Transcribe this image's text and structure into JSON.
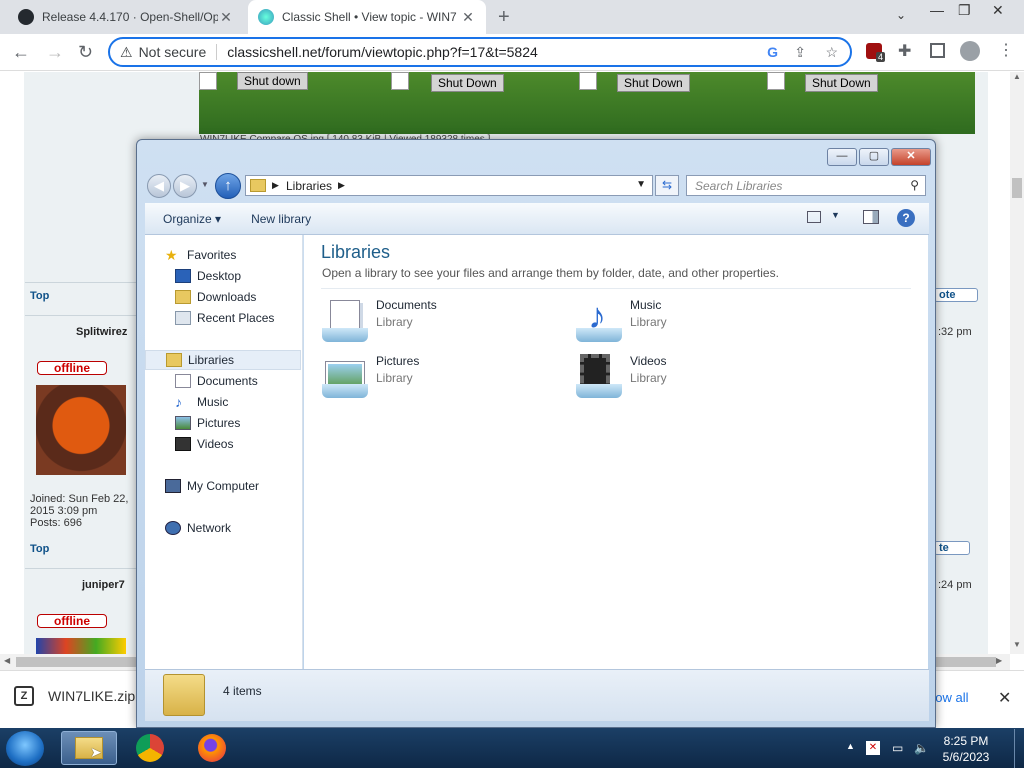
{
  "browser": {
    "tabs": [
      {
        "title": "Release 4.4.170 · Open-Shell/Ope",
        "close": "✕"
      },
      {
        "title": "Classic Shell • View topic - WIN7",
        "close": "✕"
      }
    ],
    "new_tab": "+",
    "nav": {
      "back": "←",
      "forward": "→",
      "reload": "↻"
    },
    "address": {
      "warning": "Not secure",
      "url": "classicshell.net/forum/viewtopic.php?f=17&t=5824"
    },
    "extension_badge": "4",
    "window_buttons": {
      "minimize": "—",
      "restore": "❐",
      "close": "✕"
    }
  },
  "forum": {
    "shutdown_buttons": [
      "Shut down",
      "Shut Down",
      "Shut Down",
      "Shut Down"
    ],
    "attachment_caption": "WIN7LIKE Compare OS.jpg [ 140.83 KiB | Viewed 189328 times ]",
    "top_link": "Top",
    "posts": [
      {
        "author": "Splitwirez",
        "status": "offline",
        "joined": "Joined: Sun Feb 22, 2015 3:09 pm",
        "posts": "Posts: 696",
        "time": ":32 pm",
        "quote": "ote"
      },
      {
        "author": "juniper7",
        "status": "offline",
        "time": ":24 pm",
        "quote": "te"
      }
    ]
  },
  "download_bar": {
    "file": "WIN7LIKE.zip",
    "show_all": "how all",
    "close": "✕"
  },
  "explorer": {
    "controls": {
      "minimize": "—",
      "maximize": "▢",
      "close": "✕"
    },
    "breadcrumb": "Libraries",
    "search_placeholder": "Search Libraries",
    "commands": {
      "organize": "Organize",
      "new_library": "New library"
    },
    "nav": {
      "favorites": {
        "label": "Favorites",
        "items": [
          "Desktop",
          "Downloads",
          "Recent Places"
        ]
      },
      "libraries": {
        "label": "Libraries",
        "items": [
          "Documents",
          "Music",
          "Pictures",
          "Videos"
        ]
      },
      "computer": "My Computer",
      "network": "Network"
    },
    "title": "Libraries",
    "subtitle": "Open a library to see your files and arrange them by folder, date, and other properties.",
    "libraries": [
      {
        "name": "Documents",
        "type": "Library"
      },
      {
        "name": "Music",
        "type": "Library"
      },
      {
        "name": "Pictures",
        "type": "Library"
      },
      {
        "name": "Videos",
        "type": "Library"
      }
    ],
    "status": "4 items"
  },
  "taskbar": {
    "time": "8:25 PM",
    "date": "5/6/2023"
  },
  "colors": {
    "taskbar": "#1b3f66",
    "accent": "#1a73e8",
    "explorer_title": "#1e5e8a"
  }
}
